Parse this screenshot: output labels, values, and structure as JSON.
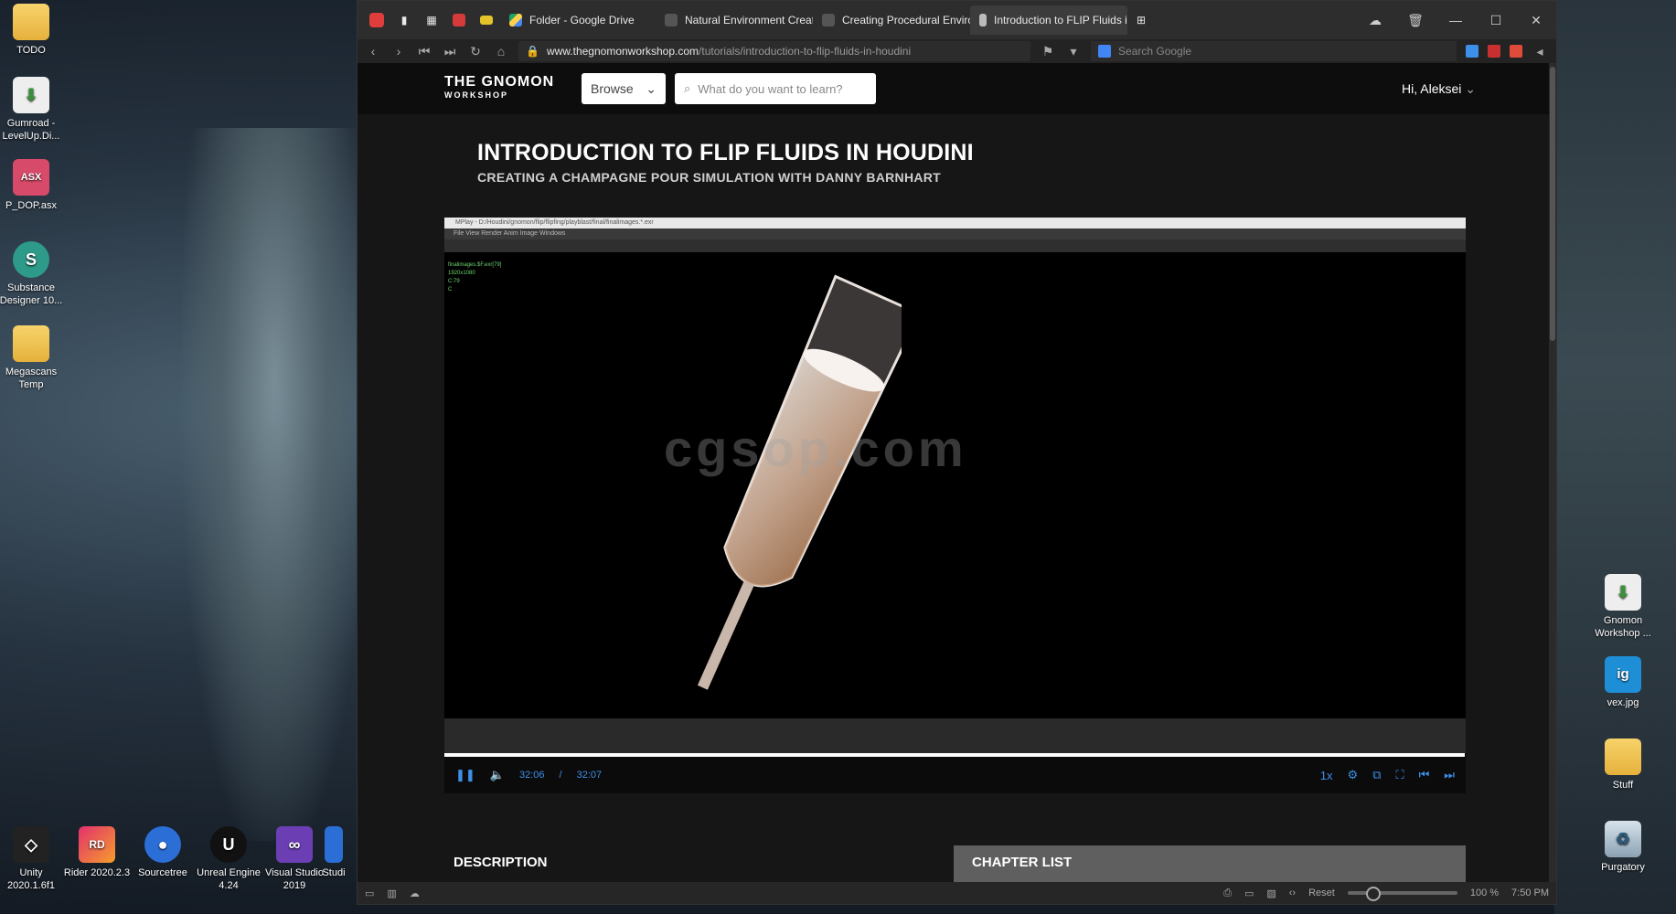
{
  "desktop": {
    "left_icons": [
      {
        "label": "TODO",
        "icon": "folder-icon"
      },
      {
        "label": "Gumroad - LevelUp.Di...",
        "icon": "torrent-icon"
      },
      {
        "label": "P_DOP.asx",
        "icon": "asx-file-icon",
        "badge": "ASX"
      },
      {
        "label": "Substance Designer 10...",
        "icon": "substance-icon"
      },
      {
        "label": "Megascans Temp",
        "icon": "folder-icon"
      }
    ],
    "taskbar_icons": [
      {
        "label": "Unity 2020.1.6f1"
      },
      {
        "label": "Rider 2020.2.3",
        "badge": "RD"
      },
      {
        "label": "Sourcetree"
      },
      {
        "label": "Unreal Engine 4.24"
      },
      {
        "label": "Visual Studio 2019"
      },
      {
        "label": "Studi"
      }
    ],
    "right_icons": [
      {
        "label": "Gnomon Workshop ...",
        "icon": "torrent-icon"
      },
      {
        "label": "vex.jpg",
        "icon": "image-icon",
        "badge": "ig"
      },
      {
        "label": "Stuff",
        "icon": "folder-icon"
      },
      {
        "label": "Purgatory",
        "icon": "recycle-bin-icon"
      }
    ]
  },
  "browser": {
    "tabs": [
      {
        "label": "Folder - Google Drive"
      },
      {
        "label": "Natural Environment Creati"
      },
      {
        "label": "Creating Procedural Enviro"
      },
      {
        "label": "Introduction to FLIP Fluids i"
      }
    ],
    "url_domain": "www.thegnomonworkshop.com",
    "url_path": "/tutorials/introduction-to-flip-fluids-in-houdini",
    "search_placeholder": "Search Google",
    "status": {
      "reset": "Reset",
      "zoom": "100 %",
      "time": "7:50 PM"
    }
  },
  "site": {
    "logo_line1": "THE GNOMON",
    "logo_line2": "WORKSHOP",
    "browse_label": "Browse",
    "search_placeholder": "What do you want to learn?",
    "user_greeting": "Hi, Aleksei",
    "title": "INTRODUCTION TO FLIP FLUIDS IN HOUDINI",
    "subtitle": "CREATING A CHAMPAGNE POUR SIMULATION WITH DANNY BARNHART",
    "tab_description": "DESCRIPTION",
    "tab_chapters": "CHAPTER LIST"
  },
  "video": {
    "mplay_title": "MPlay - D:/Houdini/gnomon/flip/flipfing/playblast/final/finalimages.*.exr",
    "mplay_menu": "File   View   Render   Anim   Image   Windows",
    "info_lines": [
      "finalimages.$F.exr[79]",
      "1920x1080",
      "C:79",
      "C"
    ],
    "watermark": "cgsop.com",
    "current_time": "32:06",
    "separator": "/",
    "duration": "32:07",
    "speed": "1x",
    "progress": 0.999
  }
}
